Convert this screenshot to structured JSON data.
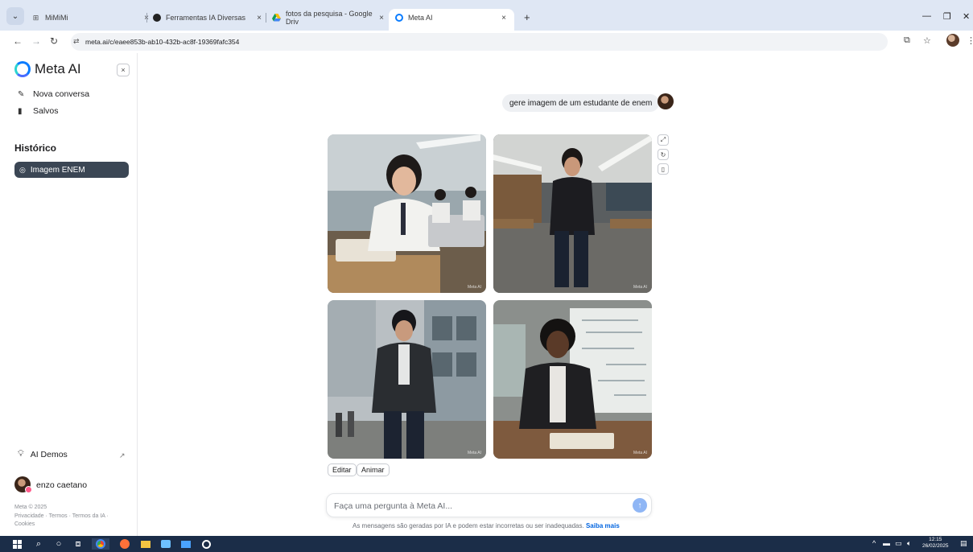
{
  "browser": {
    "tabs": [
      {
        "label": "MiMiMi",
        "active": false
      },
      {
        "label": "Ferramentas IA Diversas",
        "active": false
      },
      {
        "label": "fotos da pesquisa - Google Driv",
        "active": false
      },
      {
        "label": "Meta AI",
        "active": true
      }
    ],
    "new_tab": "+",
    "url": "meta.ai/c/eaee853b-ab10-432b-ac8f-19369fafc354"
  },
  "sidebar": {
    "brand": "Meta AI",
    "new_chat": "Nova conversa",
    "saved": "Salvos",
    "history_title": "Histórico",
    "history_items": [
      {
        "label": "Imagem ENEM"
      }
    ],
    "ai_demos": "AI Demos",
    "user_name": "enzo caetano",
    "copyright": "Meta © 2025",
    "legal_line1": "Privacidade · Termos · Termos da IA ·",
    "legal_line2": "Cookies"
  },
  "chat": {
    "user_message": "gere imagem de um estudante de enem",
    "image_watermark": "Meta AI",
    "actions": {
      "edit": "Editar",
      "animate": "Animar"
    },
    "input_placeholder": "Faça uma pergunta à Meta AI...",
    "disclaimer": "As mensagens são geradas por IA e podem estar incorretas ou ser inadequadas.",
    "learn_more": "Saiba mais"
  },
  "taskbar": {
    "time": "12:15",
    "date": "26/02/2025"
  },
  "colors": {
    "accent": "#0064e0",
    "history_active_bg": "#3b4654",
    "taskbar_bg": "#1b2d48",
    "tabbar_bg": "#dfe7f4"
  }
}
